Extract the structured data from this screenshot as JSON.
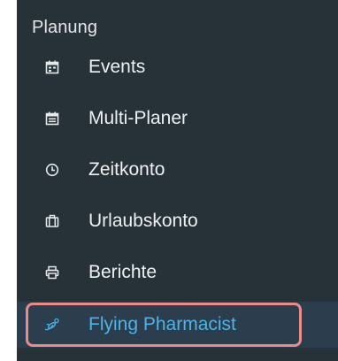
{
  "sidebar": {
    "section_title": "Planung",
    "items": [
      {
        "label": "Events",
        "icon": "calendar-icon",
        "active": false
      },
      {
        "label": "Multi-Planer",
        "icon": "calendar-multi-icon",
        "active": false
      },
      {
        "label": "Zeitkonto",
        "icon": "clock-icon",
        "active": false
      },
      {
        "label": "Urlaubskonto",
        "icon": "suitcase-icon",
        "active": false
      },
      {
        "label": "Berichte",
        "icon": "printer-icon",
        "active": false
      },
      {
        "label": "Flying Pharmacist",
        "icon": "pharmacy-icon",
        "active": true
      }
    ]
  },
  "colors": {
    "background": "#263238",
    "text": "#eef0f1",
    "active_text": "#4fb3e8",
    "highlight_border": "#e78b8b"
  }
}
